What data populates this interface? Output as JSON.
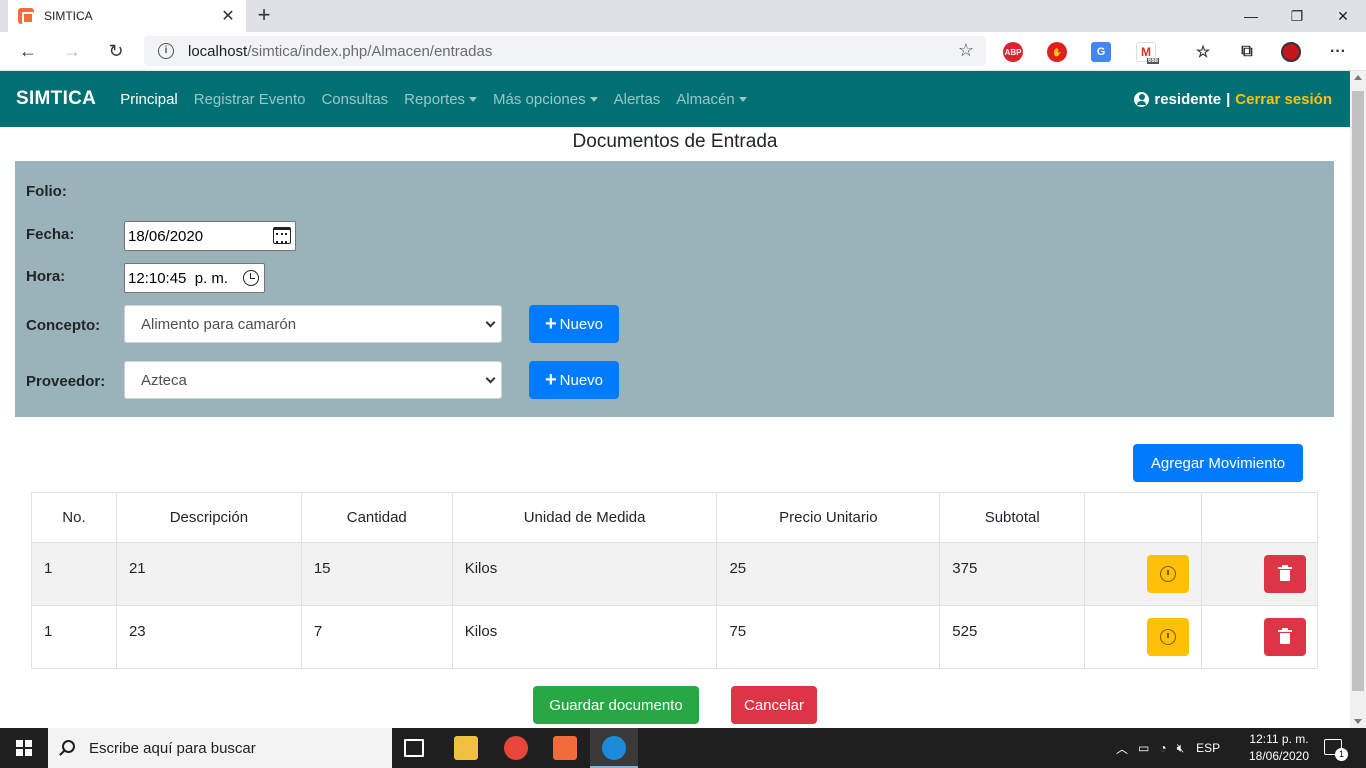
{
  "browser": {
    "tab_title": "SIMTICA",
    "url_host": "localhost",
    "url_path": "/simtica/index.php/Almacen/entradas",
    "ext_abp": "ABP",
    "ext_mail_badge": "688"
  },
  "nav": {
    "brand": "SIMTICA",
    "links": [
      "Principal",
      "Registrar Evento",
      "Consultas",
      "Reportes",
      "Más opciones",
      "Alertas",
      "Almacén"
    ],
    "user": "residente",
    "separator": "|",
    "logout": "Cerrar sesión"
  },
  "page": {
    "title": "Documentos de Entrada"
  },
  "form": {
    "folio_label": "Folio:",
    "fecha_label": "Fecha:",
    "fecha_value": "18/06/2020",
    "hora_label": "Hora:",
    "hora_value": "12:10:45  p. m.",
    "concepto_label": "Concepto:",
    "concepto_value": "Alimento para camarón",
    "proveedor_label": "Proveedor:",
    "proveedor_value": "Azteca",
    "nuevo_label": "Nuevo"
  },
  "actions": {
    "add_movement": "Agregar Movimiento",
    "save": "Guardar documento",
    "cancel": "Cancelar"
  },
  "table": {
    "headers": [
      "No.",
      "Descripción",
      "Cantidad",
      "Unidad de Medida",
      "Precio Unitario",
      "Subtotal",
      "",
      ""
    ],
    "rows": [
      [
        "1",
        "21",
        "15",
        "Kilos",
        "25",
        "375"
      ],
      [
        "1",
        "23",
        "7",
        "Kilos",
        "75",
        "525"
      ]
    ]
  },
  "taskbar": {
    "search_placeholder": "Escribe aquí para buscar",
    "lang": "ESP",
    "time": "12:11 p. m.",
    "date": "18/06/2020",
    "notif_count": "1"
  },
  "colors": {
    "navbar": "#007074",
    "panel": "#9ab2b9",
    "primary": "#007bff",
    "success": "#28a745",
    "danger": "#dc3545",
    "warning": "#ffc107",
    "logout": "#ffc107"
  }
}
